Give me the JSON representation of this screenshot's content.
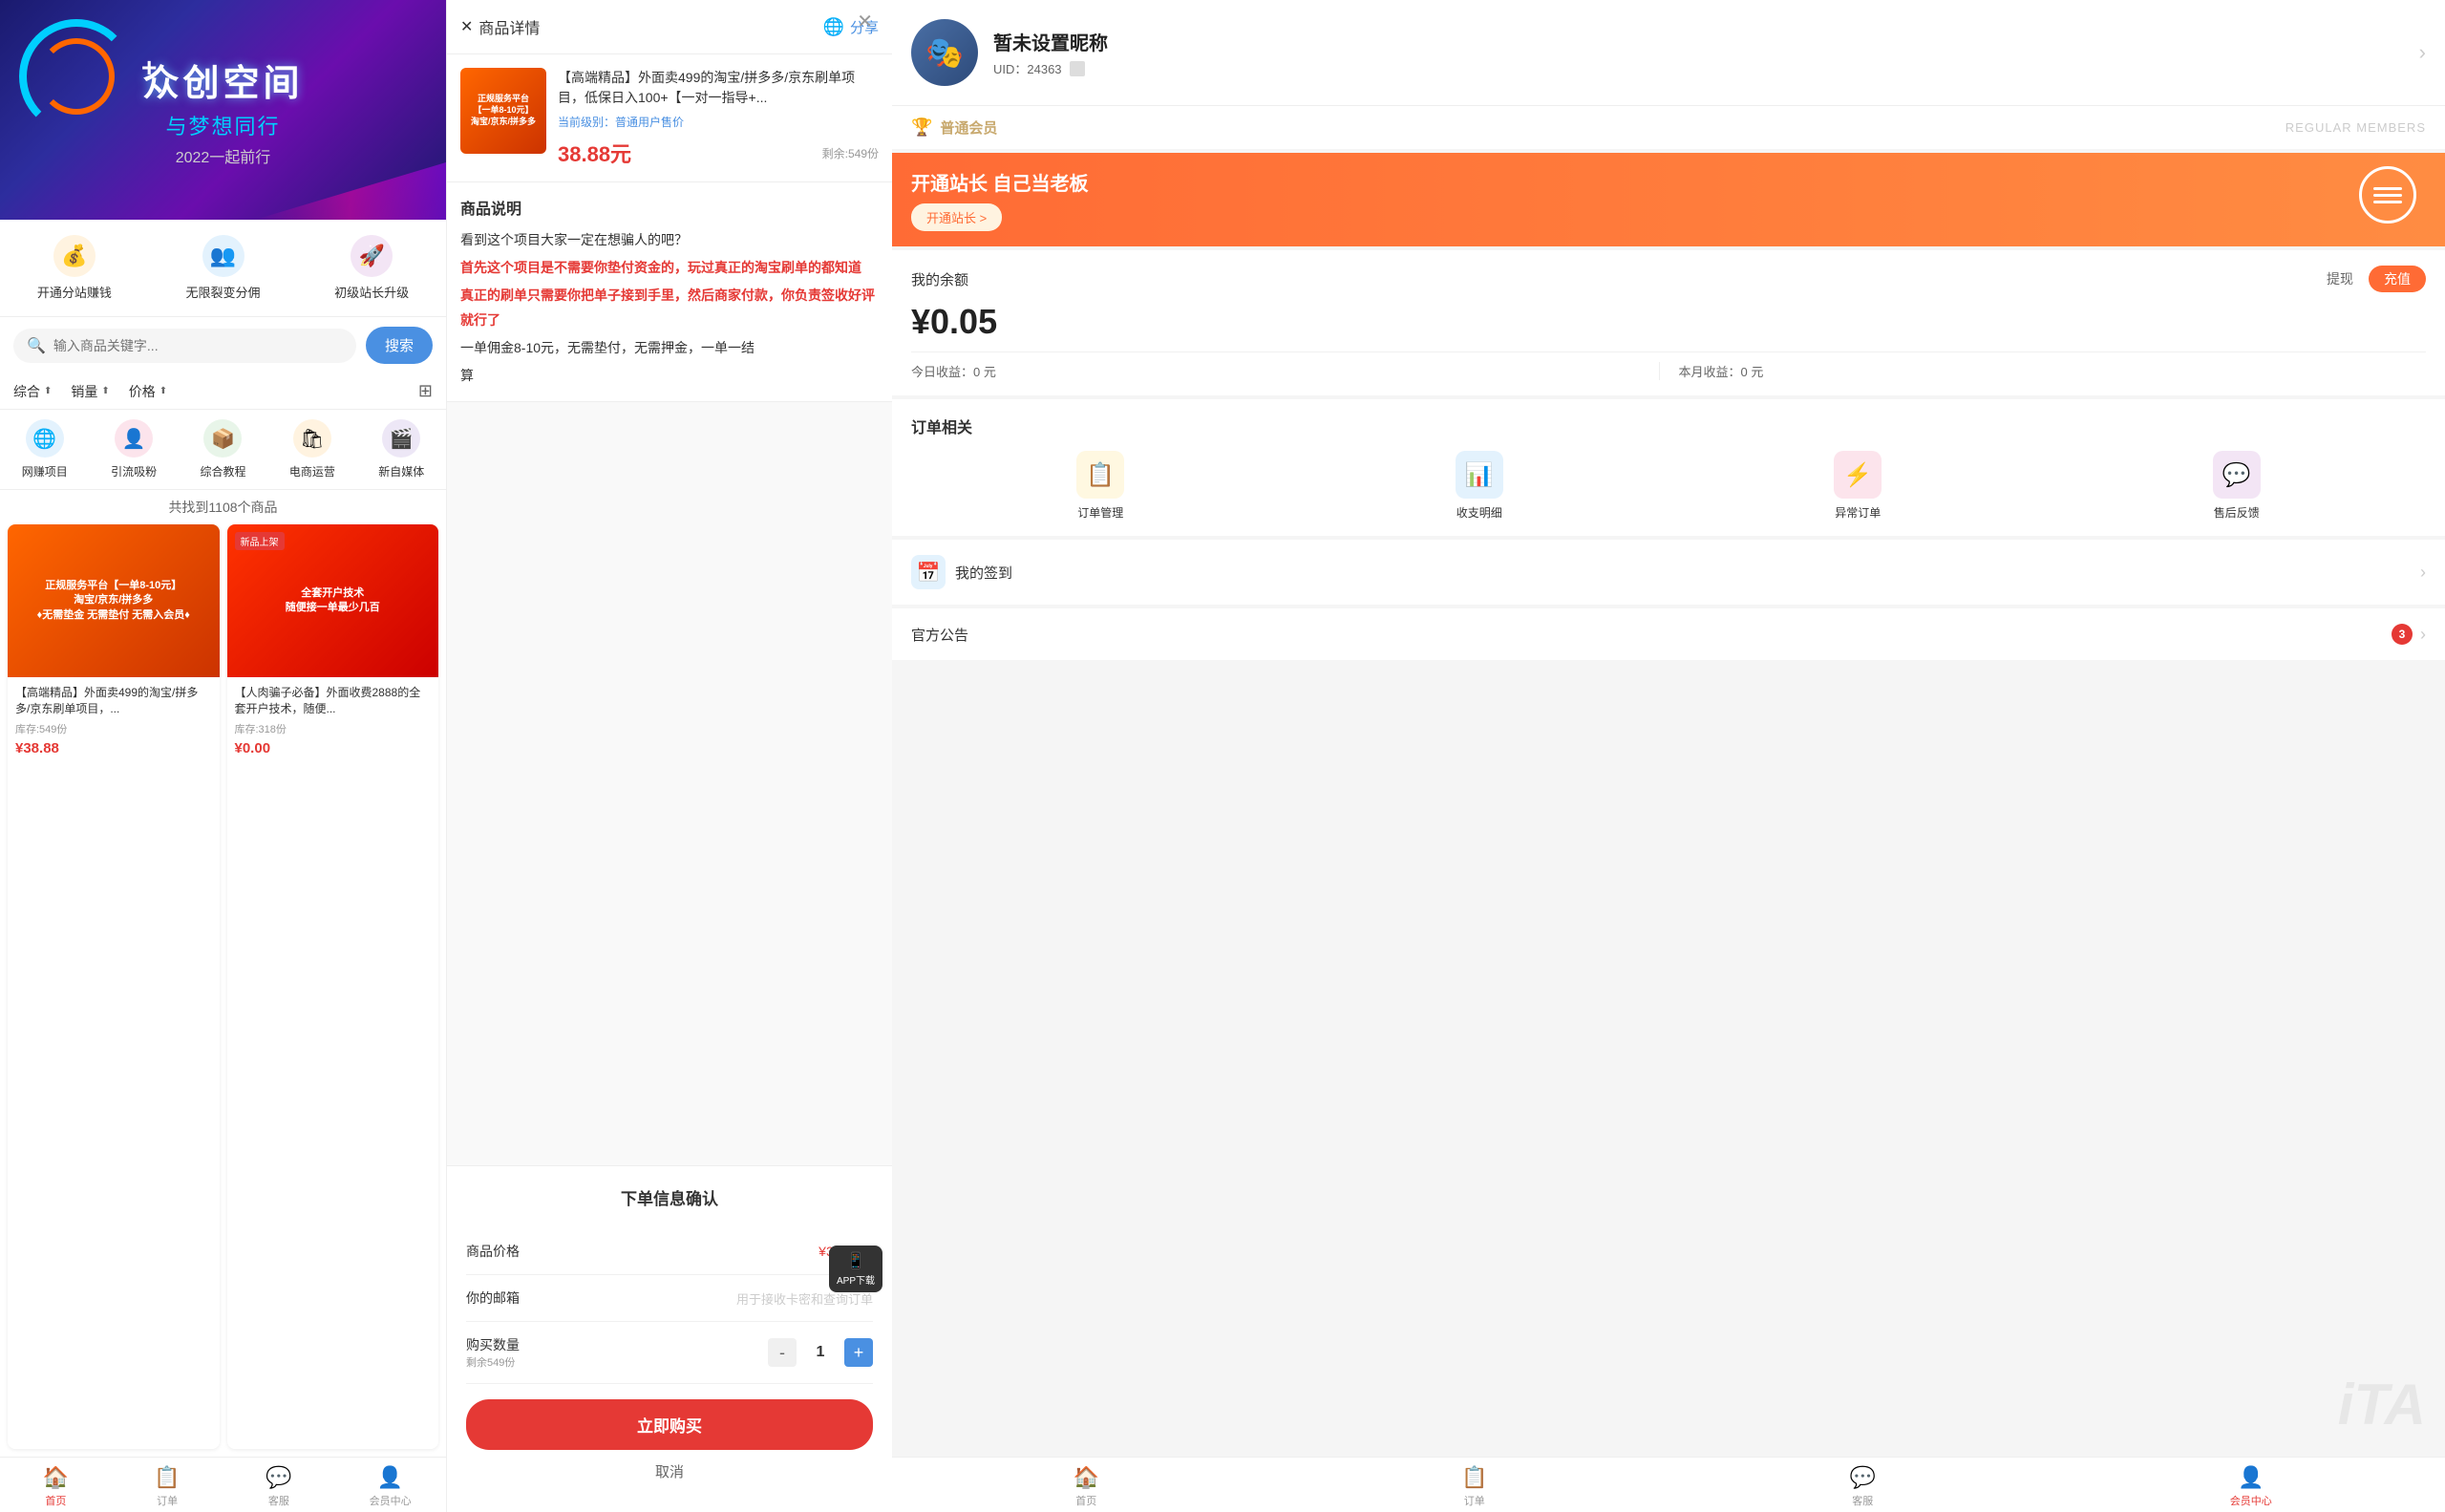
{
  "left_panel": {
    "banner": {
      "title": "众创空间",
      "subtitle": "与梦想同行",
      "year": "2022一起前行"
    },
    "quick_actions": [
      {
        "label": "开通分站赚钱",
        "icon": "💰"
      },
      {
        "label": "无限裂变分佣",
        "icon": "👥"
      },
      {
        "label": "初级站长升级",
        "icon": "🚀"
      }
    ],
    "search": {
      "placeholder": "输入商品关键字...",
      "button": "搜索"
    },
    "filters": [
      {
        "label": "综合",
        "has_arrow": true
      },
      {
        "label": "销量",
        "has_arrow": true
      },
      {
        "label": "价格",
        "has_arrow": true
      }
    ],
    "categories": [
      {
        "label": "网赚项目",
        "icon": "🌐"
      },
      {
        "label": "引流吸粉",
        "icon": "👤"
      },
      {
        "label": "综合教程",
        "icon": "📦"
      },
      {
        "label": "电商运营",
        "icon": "🛍"
      },
      {
        "label": "新自媒体",
        "icon": "🎬"
      }
    ],
    "result_count": "共找到1108个商品",
    "products": [
      {
        "title": "【高端精品】外面卖499的淘宝/拼多多/京东刷单项目，...",
        "stock": "库存:549份",
        "price": "¥38.88",
        "badge": "",
        "img_text": "正规服务平台【一单8-10元】\n淘宝/京东/拼多多\n♦ ♦无需垫金 无需垫付 无需入会员♦ ♦"
      },
      {
        "title": "【人肉骗子必备】外面收费2888的全套开户技术，随便...",
        "stock": "库存:318份",
        "price": "¥0.00",
        "badge": "新品上架",
        "img_text": "全套开户技术\n随便接一单最少几百"
      }
    ],
    "bottom_nav": [
      {
        "label": "首页",
        "icon": "🏠",
        "active": true
      },
      {
        "label": "订单",
        "icon": "📋",
        "active": false
      },
      {
        "label": "客服",
        "icon": "💬",
        "active": false
      },
      {
        "label": "会员中心",
        "icon": "👤",
        "active": false
      }
    ]
  },
  "middle_panel": {
    "header": {
      "close_label": "商品详情",
      "share_label": "分享",
      "share_icon": "🔵"
    },
    "product": {
      "title": "【高端精品】外面卖499的淘宝/拼多多/京东刷单项目，低保日入100+【一对一指导+...",
      "category_label": "当前级别：",
      "category_value": "普通用户售价",
      "price": "38.88元",
      "stock": "剩余:549份"
    },
    "description": {
      "title": "商品说明",
      "lines": [
        {
          "text": "看到这个项目大家一定在想骗人的吧？",
          "type": "normal"
        },
        {
          "text": "首先这个项目是不需要你垫付资金的，玩过真正的淘宝刷单的都知道",
          "type": "highlight"
        },
        {
          "text": "真正的刷单只需要你把单子接到手里，然后商家付款，你负责签收好评就行了",
          "type": "highlight"
        },
        {
          "text": "一单佣金8-10元，无需垫付，无需押金，一单一结",
          "type": "normal"
        },
        {
          "text": "算",
          "type": "normal"
        }
      ]
    },
    "order_modal": {
      "title": "下单信息确认",
      "price_label": "商品价格",
      "price_value": "¥38.88元",
      "email_label": "你的邮箱",
      "email_placeholder": "用于接收卡密和查询订单",
      "qty_label": "购买数量",
      "qty_stock": "剩余549份",
      "qty_value": 1,
      "qty_minus": "-",
      "qty_plus": "+",
      "buy_label": "立即购买",
      "cancel_label": "取消"
    }
  },
  "right_panel": {
    "profile": {
      "name": "暂未设置昵称",
      "uid": "UID：24363",
      "avatar_emoji": "🎭"
    },
    "member": {
      "label": "普通会员",
      "right_label": "REGULAR MEMBERS",
      "icon": "🏆"
    },
    "promo": {
      "title": "开通站长 自己当老板",
      "btn_label": "开通站长 >"
    },
    "balance": {
      "title": "我的余额",
      "withdraw": "提现",
      "recharge": "充值",
      "amount": "¥0.05",
      "today_label": "今日收益：0 元",
      "month_label": "本月收益：0 元"
    },
    "orders": {
      "title": "订单相关",
      "items": [
        {
          "label": "订单管理",
          "icon": "📋",
          "color": "oi-yellow"
        },
        {
          "label": "收支明细",
          "icon": "📊",
          "color": "oi-blue"
        },
        {
          "label": "异常订单",
          "icon": "⚡",
          "color": "oi-red"
        },
        {
          "label": "售后反馈",
          "icon": "💬",
          "color": "oi-purple"
        }
      ]
    },
    "checkin": {
      "label": "我的签到",
      "icon": "📅"
    },
    "notice": {
      "label": "官方公告",
      "badge": "3"
    },
    "bottom_nav": [
      {
        "label": "首页",
        "icon": "🏠",
        "active": false
      },
      {
        "label": "订单",
        "icon": "📋",
        "active": false
      },
      {
        "label": "客服",
        "icon": "💬",
        "active": false
      },
      {
        "label": "会员中心",
        "icon": "👤",
        "active": true
      }
    ],
    "watermark": "iTA"
  }
}
